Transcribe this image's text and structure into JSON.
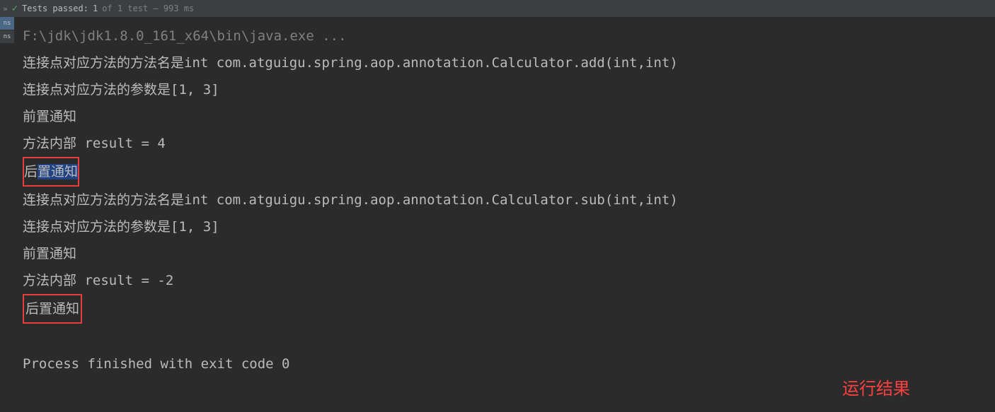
{
  "toolbar": {
    "arrows_icon": "»",
    "tests_passed_label": "Tests passed:",
    "tests_count": "1",
    "tests_detail": "of 1 test – 993 ms"
  },
  "side_tabs": {
    "tab1": "ns",
    "tab2": "ns"
  },
  "console": {
    "line_exec": "F:\\jdk\\jdk1.8.0_161_x64\\bin\\java.exe ...",
    "line1": "连接点对应方法的方法名是int com.atguigu.spring.aop.annotation.Calculator.add(int,int)",
    "line2": "连接点对应方法的参数是[1, 3]",
    "line3": "前置通知",
    "line4": "方法内部 result = 4",
    "line5_prefix": "后",
    "line5_highlight": "置通知",
    "line6": "连接点对应方法的方法名是int com.atguigu.spring.aop.annotation.Calculator.sub(int,int)",
    "line7": "连接点对应方法的参数是[1, 3]",
    "line8": "前置通知",
    "line9": "方法内部 result = -2",
    "line10": "后置通知",
    "line_exit": "Process finished with exit code 0"
  },
  "annotation": {
    "label": "运行结果"
  }
}
